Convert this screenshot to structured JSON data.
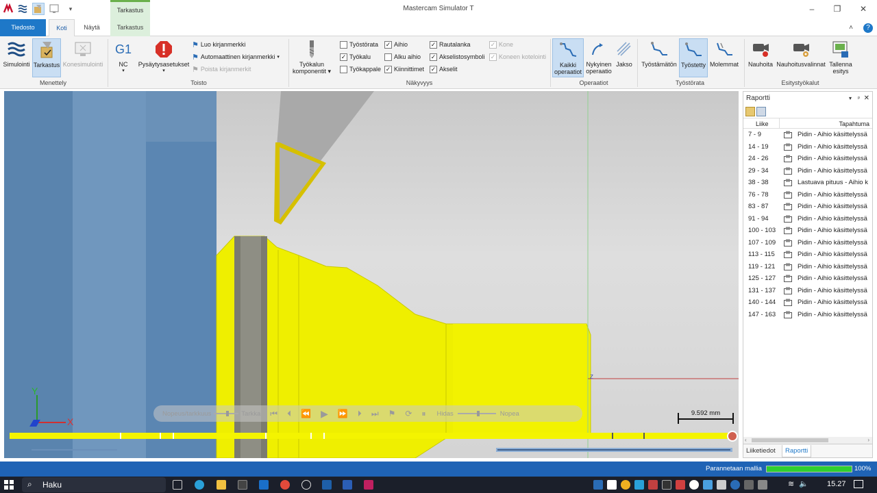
{
  "window": {
    "app_title": "Mastercam Simulator  T",
    "context_tab_title": "Tarkastus",
    "minimize": "–",
    "maximize": "❐",
    "close": "✕"
  },
  "tabs": {
    "file": "Tiedosto",
    "home": "Koti",
    "view": "Näytä",
    "verify": "Tarkastus"
  },
  "ribbon": {
    "groups": {
      "mode": "Menettely",
      "playback": "Toisto",
      "visibility": "Näkyvyys",
      "operations": "Operaatiot",
      "toolpath": "Työstörata",
      "recording": "Esitystyökalut"
    },
    "simulation": "Simulointi",
    "verify": "Tarkastus",
    "machine_sim": "Konesimulointi",
    "nc_glyph": "G1",
    "nc": "NC",
    "stop_settings": "Pysäytysasetukset",
    "create_bookmark": "Luo kirjanmerkki",
    "auto_bookmark": "Automaattinen kirjanmerkki",
    "remove_bookmarks": "Poista kirjanmerkit",
    "tool_components_1": "Työkalun",
    "tool_components_2": "komponentit",
    "checks": {
      "toolpath": {
        "label": "Työstörata",
        "checked": false
      },
      "tool": {
        "label": "Työkalu",
        "checked": true
      },
      "workpiece": {
        "label": "Työkappale",
        "checked": false
      },
      "stock": {
        "label": "Aihio",
        "checked": true
      },
      "initial_stock": {
        "label": "Alku aihio",
        "checked": false
      },
      "fixtures": {
        "label": "Kiinnittimet",
        "checked": true
      },
      "wireframe": {
        "label": "Rautalanka",
        "checked": true
      },
      "axis_symbol": {
        "label": "Akselistosymboli",
        "checked": true
      },
      "axes": {
        "label": "Akselit",
        "checked": true
      },
      "machine": {
        "label": "Kone",
        "checked": true
      },
      "machine_housing": {
        "label": "Koneen kotelointi",
        "checked": true
      }
    },
    "all_ops_1": "Kaikki",
    "all_ops_2": "operaatiot",
    "current_op_1": "Nykyinen",
    "current_op_2": "operaatio",
    "cycle": "Jakso",
    "unmachined": "Työstämätön",
    "machined": "Työstetty",
    "both": "Molemmat",
    "record": "Nauhoita",
    "record_options": "Nauhoitusvalinnat",
    "save_1": "Tallenna",
    "save_2": "esitys"
  },
  "viewport": {
    "speed_label": "Nopeus/tarkkuus",
    "accurate": "Tarkka",
    "slow": "Hidas",
    "fast": "Nopea",
    "scale_text": "9.592 mm",
    "axis_y": "Y",
    "axis_x": "X",
    "axis_z": "Z"
  },
  "report": {
    "title": "Raportti",
    "col_move": "Liike",
    "col_event": "Tapahtuma",
    "rows": [
      {
        "range": "7 - 9",
        "event": "Pidin - Aihio käsittelyssä"
      },
      {
        "range": "14 - 19",
        "event": "Pidin - Aihio käsittelyssä"
      },
      {
        "range": "24 - 26",
        "event": "Pidin - Aihio käsittelyssä"
      },
      {
        "range": "29 - 34",
        "event": "Pidin - Aihio käsittelyssä"
      },
      {
        "range": "38 - 38",
        "event": "Lastuava pituus - Aihio k"
      },
      {
        "range": "76 - 78",
        "event": "Pidin - Aihio käsittelyssä"
      },
      {
        "range": "83 - 87",
        "event": "Pidin - Aihio käsittelyssä"
      },
      {
        "range": "91 - 94",
        "event": "Pidin - Aihio käsittelyssä"
      },
      {
        "range": "100 - 103",
        "event": "Pidin - Aihio käsittelyssä"
      },
      {
        "range": "107 - 109",
        "event": "Pidin - Aihio käsittelyssä"
      },
      {
        "range": "113 - 115",
        "event": "Pidin - Aihio käsittelyssä"
      },
      {
        "range": "119 - 121",
        "event": "Pidin - Aihio käsittelyssä"
      },
      {
        "range": "125 - 127",
        "event": "Pidin - Aihio käsittelyssä"
      },
      {
        "range": "131 - 137",
        "event": "Pidin - Aihio käsittelyssä"
      },
      {
        "range": "140 - 144",
        "event": "Pidin - Aihio käsittelyssä"
      },
      {
        "range": "147 - 163",
        "event": "Pidin - Aihio käsittelyssä"
      }
    ],
    "tab_motion": "Liiketiedot",
    "tab_report": "Raportti"
  },
  "status": {
    "text": "Parannetaan mallia",
    "progress_percent": 100,
    "progress_label": "100%"
  },
  "taskbar": {
    "search": "Haku",
    "time": "15.27"
  },
  "colors": {
    "stock_yellow": "#f4f400",
    "chuck_blue": "#4f7fae",
    "accent_blue": "#1e78c8",
    "status_green": "#2fcf2f"
  }
}
